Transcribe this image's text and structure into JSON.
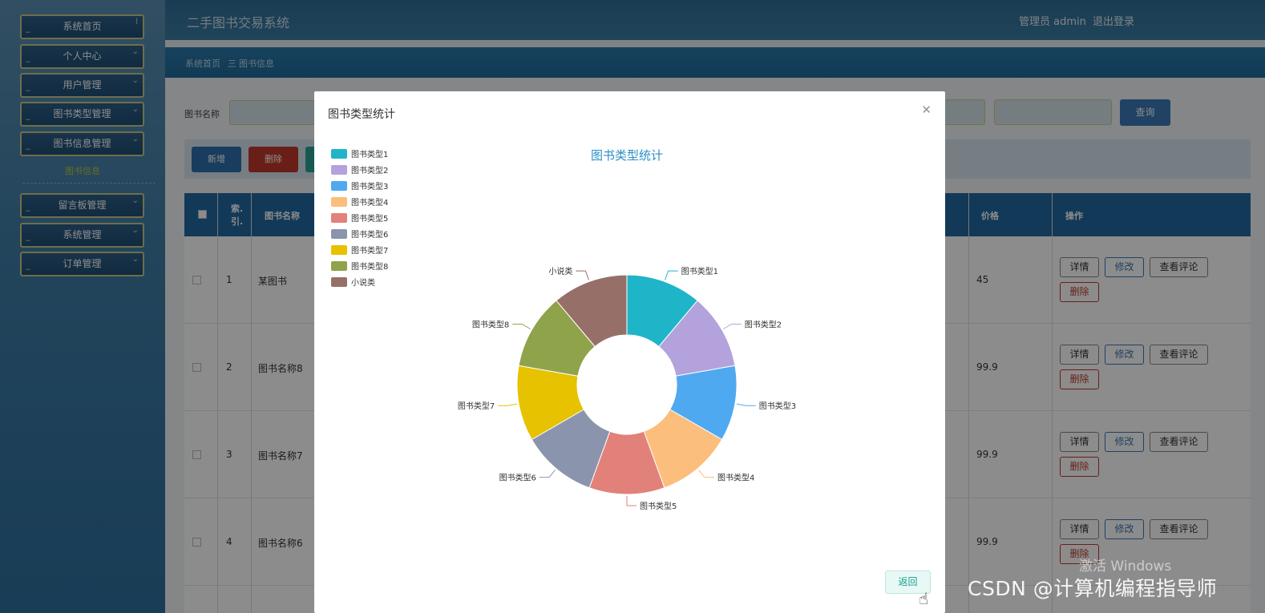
{
  "app": {
    "title": "二手图书交易系统",
    "admin_label": "管理员 admin",
    "logout_label": "退出登录"
  },
  "sidebar": {
    "items": [
      {
        "label": "系统首页"
      },
      {
        "label": "个人中心"
      },
      {
        "label": "用户管理"
      },
      {
        "label": "图书类型管理"
      },
      {
        "label": "图书信息管理"
      },
      {
        "label": "留言板管理"
      },
      {
        "label": "系统管理"
      },
      {
        "label": "订单管理"
      }
    ],
    "sub_item": "图书信息"
  },
  "breadcrumb": {
    "home": "系统首页",
    "separator": "三",
    "current": "图书信息"
  },
  "search": {
    "label": "图书名称",
    "query_button": "查询"
  },
  "toolbar": {
    "add_label": "新增",
    "delete_label": "删除"
  },
  "table": {
    "headers": {
      "index": "索引",
      "index_line1": "索.",
      "index_line2": "引.",
      "name": "图书名称",
      "price": "价格",
      "actions": "操作"
    },
    "rows": [
      {
        "index": "1",
        "name": "某图书",
        "price": "45"
      },
      {
        "index": "2",
        "name": "图书名称8",
        "price": "99.9"
      },
      {
        "index": "3",
        "name": "图书名称7",
        "price": "99.9"
      },
      {
        "index": "4",
        "name": "图书名称6",
        "price": "99.9"
      }
    ],
    "row_actions": {
      "detail": "详情",
      "edit": "修改",
      "view_comments": "查看评论",
      "delete": "删除"
    }
  },
  "modal": {
    "title": "图书类型统计",
    "close_icon": "close-icon",
    "return_label": "返回"
  },
  "chart_data": {
    "type": "pie",
    "title": "图书类型统计",
    "legend_position": "top-left",
    "categories": [
      "图书类型1",
      "图书类型2",
      "图书类型3",
      "图书类型4",
      "图书类型5",
      "图书类型6",
      "图书类型7",
      "图书类型8",
      "小说类"
    ],
    "values": [
      1,
      1,
      1,
      1,
      1,
      1,
      1,
      1,
      1
    ],
    "colors": [
      "#1fb5c8",
      "#b3a2dc",
      "#4fa9f0",
      "#fcbe7c",
      "#e1817a",
      "#8a94ad",
      "#e6c200",
      "#8fa34a",
      "#967068"
    ]
  },
  "watermark": {
    "text": "CSDN @计算机编程指导师",
    "windows_text": "激活 Windows"
  },
  "colors": {
    "header_bg": "#2f6f98",
    "accent_blue": "#3a78b8",
    "delete_red": "#c0392b",
    "return_green": "#13a391"
  }
}
